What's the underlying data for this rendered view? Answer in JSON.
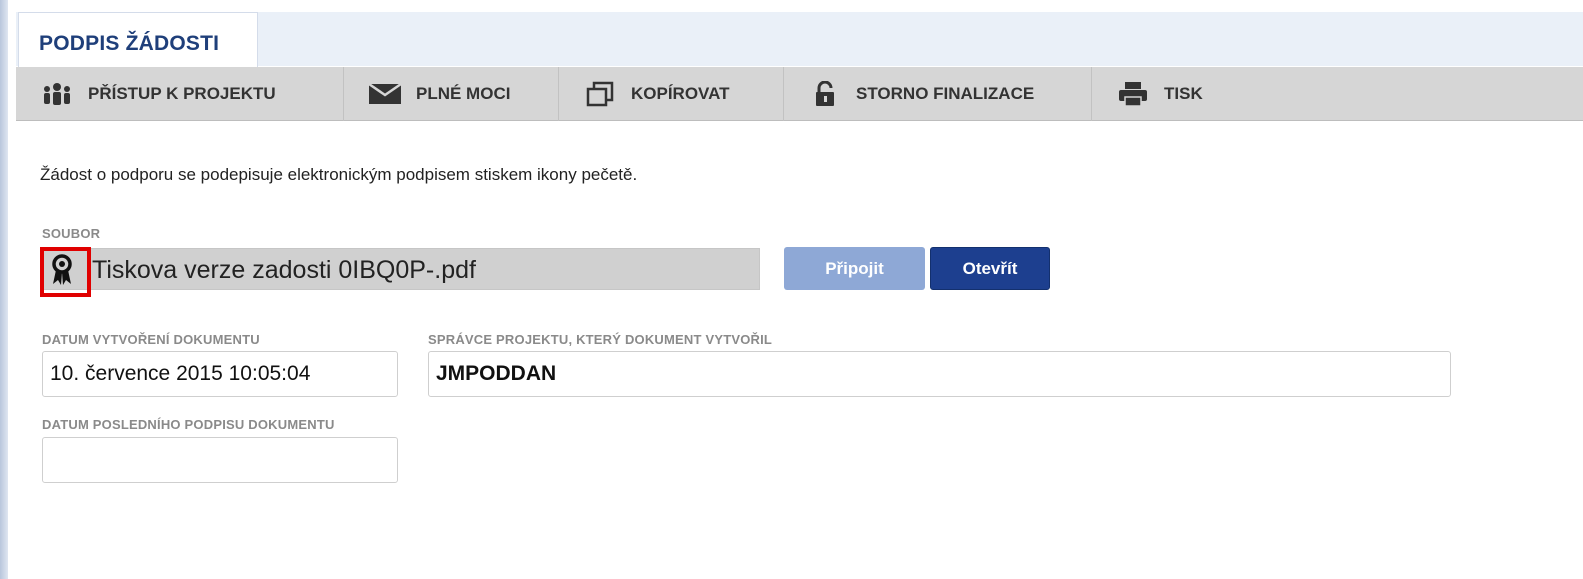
{
  "page": {
    "tab_title": "PODPIS ŽÁDOSTI"
  },
  "toolbar": {
    "items": [
      {
        "label": "PŘÍSTUP K PROJEKTU",
        "icon": "people-icon"
      },
      {
        "label": "PLNÉ MOCI",
        "icon": "envelope-icon"
      },
      {
        "label": "KOPÍROVAT",
        "icon": "copy-icon"
      },
      {
        "label": "STORNO FINALIZACE",
        "icon": "unlock-icon"
      },
      {
        "label": "TISK",
        "icon": "printer-icon"
      }
    ]
  },
  "main": {
    "intro_text": "Žádost o podporu se podepisuje elektronickým podpisem stiskem ikony pečetě.",
    "file": {
      "label": "SOUBOR",
      "name": "Tiskova verze zadosti 0IBQ0P-.pdf",
      "seal_icon": "seal-icon",
      "highlight_color": "#e00000"
    },
    "buttons": {
      "attach_label": "Připojit",
      "open_label": "Otevřít"
    },
    "created_date": {
      "label": "DATUM VYTVOŘENÍ DOKUMENTU",
      "value": "10. července 2015 10:05:04"
    },
    "project_manager": {
      "label": "SPRÁVCE PROJEKTU, KTERÝ DOKUMENT VYTVOŘIL",
      "value": "JMPODDAN"
    },
    "last_signature": {
      "label": "DATUM POSLEDNÍHO PODPISU DOKUMENTU",
      "value": ""
    }
  },
  "colors": {
    "brand": "#1f3f7a",
    "primary_button": "#1d3f8f",
    "disabled_button": "#8ea8d6",
    "toolbar_bg": "#d6d6d6"
  }
}
